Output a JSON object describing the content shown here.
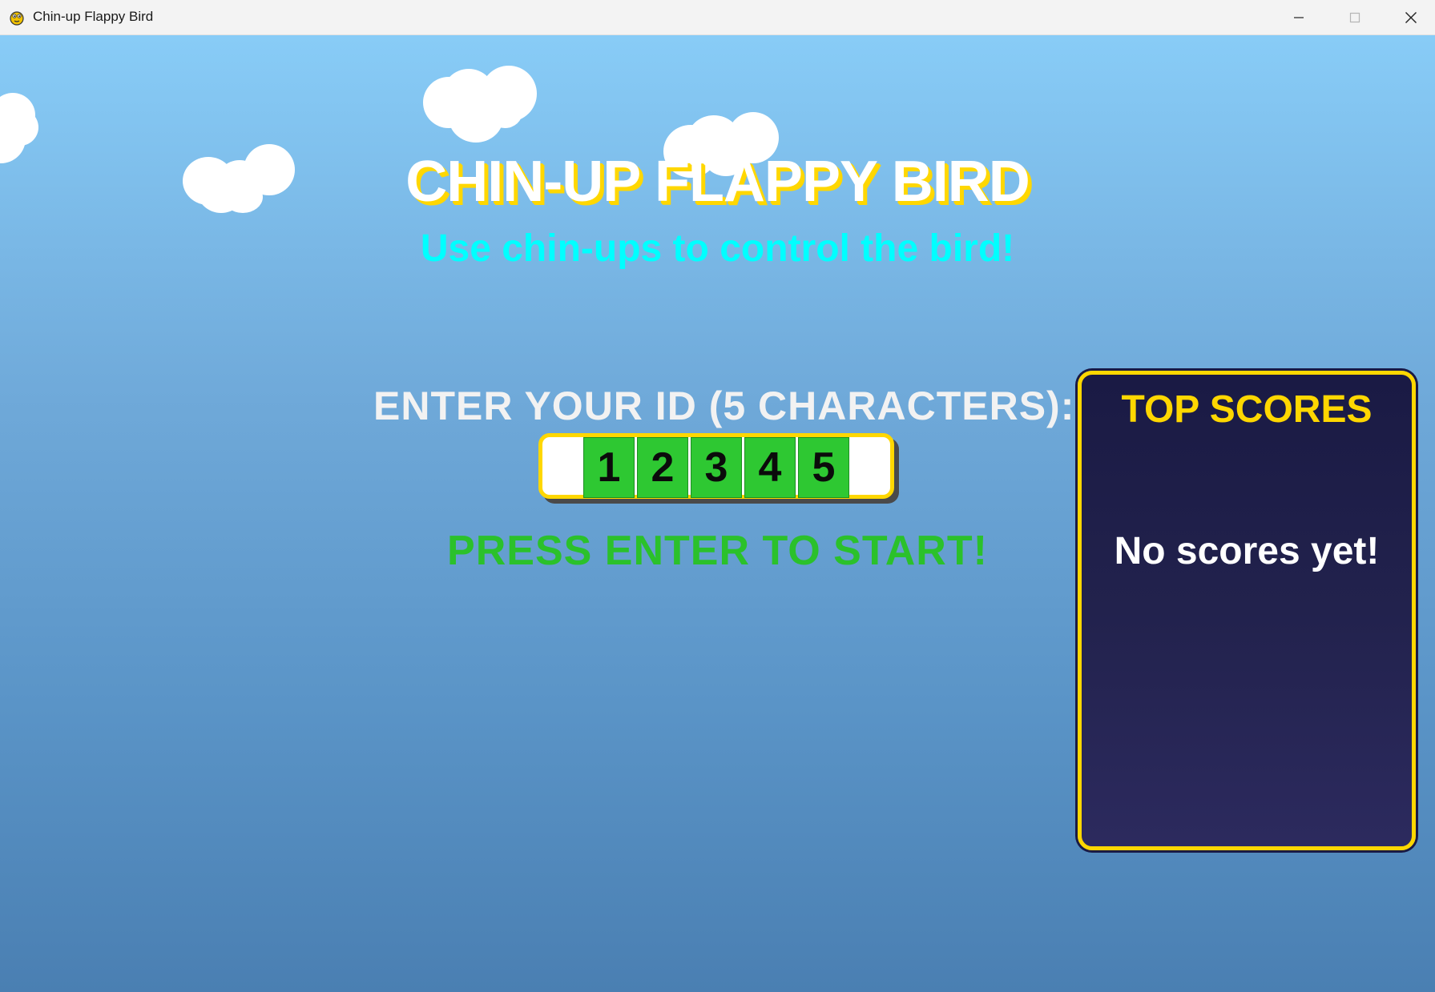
{
  "window": {
    "title": "Chin-up Flappy Bird",
    "icon": "pygame-snake-icon",
    "controls": [
      "minimize-icon",
      "maximize-icon",
      "close-icon"
    ]
  },
  "game": {
    "title": "CHIN-UP FLAPPY BIRD",
    "subtitle": "Use chin-ups to control the bird!",
    "id_prompt": "ENTER YOUR ID (5 CHARACTERS):",
    "id_chars": [
      "1",
      "2",
      "3",
      "4",
      "5"
    ],
    "start_prompt": "PRESS ENTER TO START!"
  },
  "scoreboard": {
    "title": "TOP SCORES",
    "empty_message": "No scores yet!"
  },
  "colors": {
    "sky_top": "#88ccf7",
    "sky_bottom": "#4a7fb2",
    "title_shadow": "#ffd700",
    "subtitle": "#00ffff",
    "cell_green": "#2ec832",
    "start_text": "#2bc12b",
    "panel_bg": "#1a1a44",
    "panel_border": "#ffd700"
  }
}
